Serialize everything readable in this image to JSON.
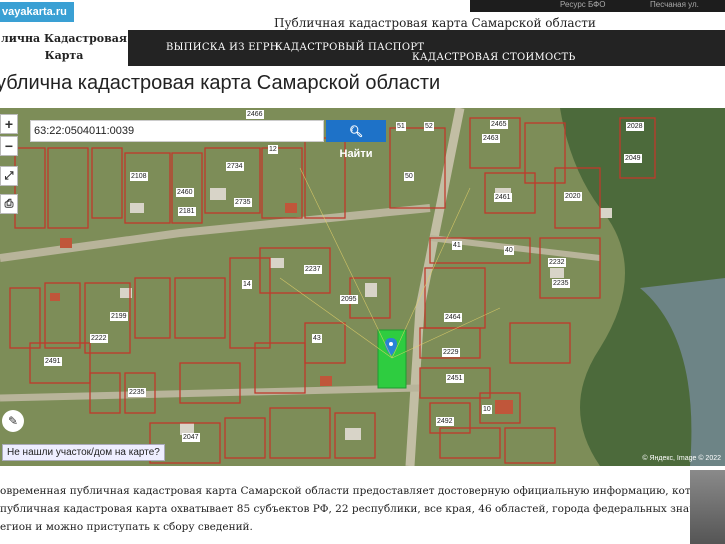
{
  "header": {
    "site_url": "vayakarta.ru",
    "title": "Публичная кадастровая карта Самарской области",
    "site_name_line1": "лична Кадастровая",
    "site_name_line2": "Карта",
    "browser_item1": "Ресурс БФО",
    "browser_item2": "Песчаная ул."
  },
  "nav": {
    "items": [
      "ВЫПИСКА ИЗ ЕГРН",
      "КАДАСТРОВЫЙ ПАСПОРТ",
      "КАДАСТРОВАЯ СТОИМОСТЬ"
    ]
  },
  "page_title": "ублична кадастровая карта Самарской области",
  "map": {
    "zoom_in": "+",
    "zoom_out": "−",
    "search_value": "63:22:0504011:0039",
    "search_button": "Найти",
    "not_found": "Не нашли участок/дом на карте?",
    "attribution": "© Яндекс, Image © 2022",
    "plot_labels": [
      "2466",
      "2465",
      "2463",
      "2028",
      "51",
      "52",
      "12",
      "2049",
      "50",
      "2734",
      "2108",
      "2460",
      "2461",
      "2020",
      "2181",
      "2735",
      "2237",
      "40",
      "41",
      "2232",
      "2235",
      "2095",
      "2464",
      "43",
      "2229",
      "2451",
      "2491",
      "2492",
      "10",
      "2047",
      "14",
      "2199",
      "2222",
      "2235"
    ]
  },
  "body_text": {
    "line1": "овременная публичная кадастровая карта Самарской области предоставляет достоверную официальную информацию, которая касается деления",
    "line2": "публичная кадастровая карта охватывает 85 субъектов РФ, 22 республики, все края, 46 областей, города федеральных значений, автономные облас",
    "line3": "егион и можно приступать к сбору сведений."
  },
  "colors": {
    "navbar": "#232323",
    "button": "#1e72c8",
    "boundary": "#c0392b",
    "selected_plot": "#2ecc40",
    "pin": "#2a82d6"
  }
}
